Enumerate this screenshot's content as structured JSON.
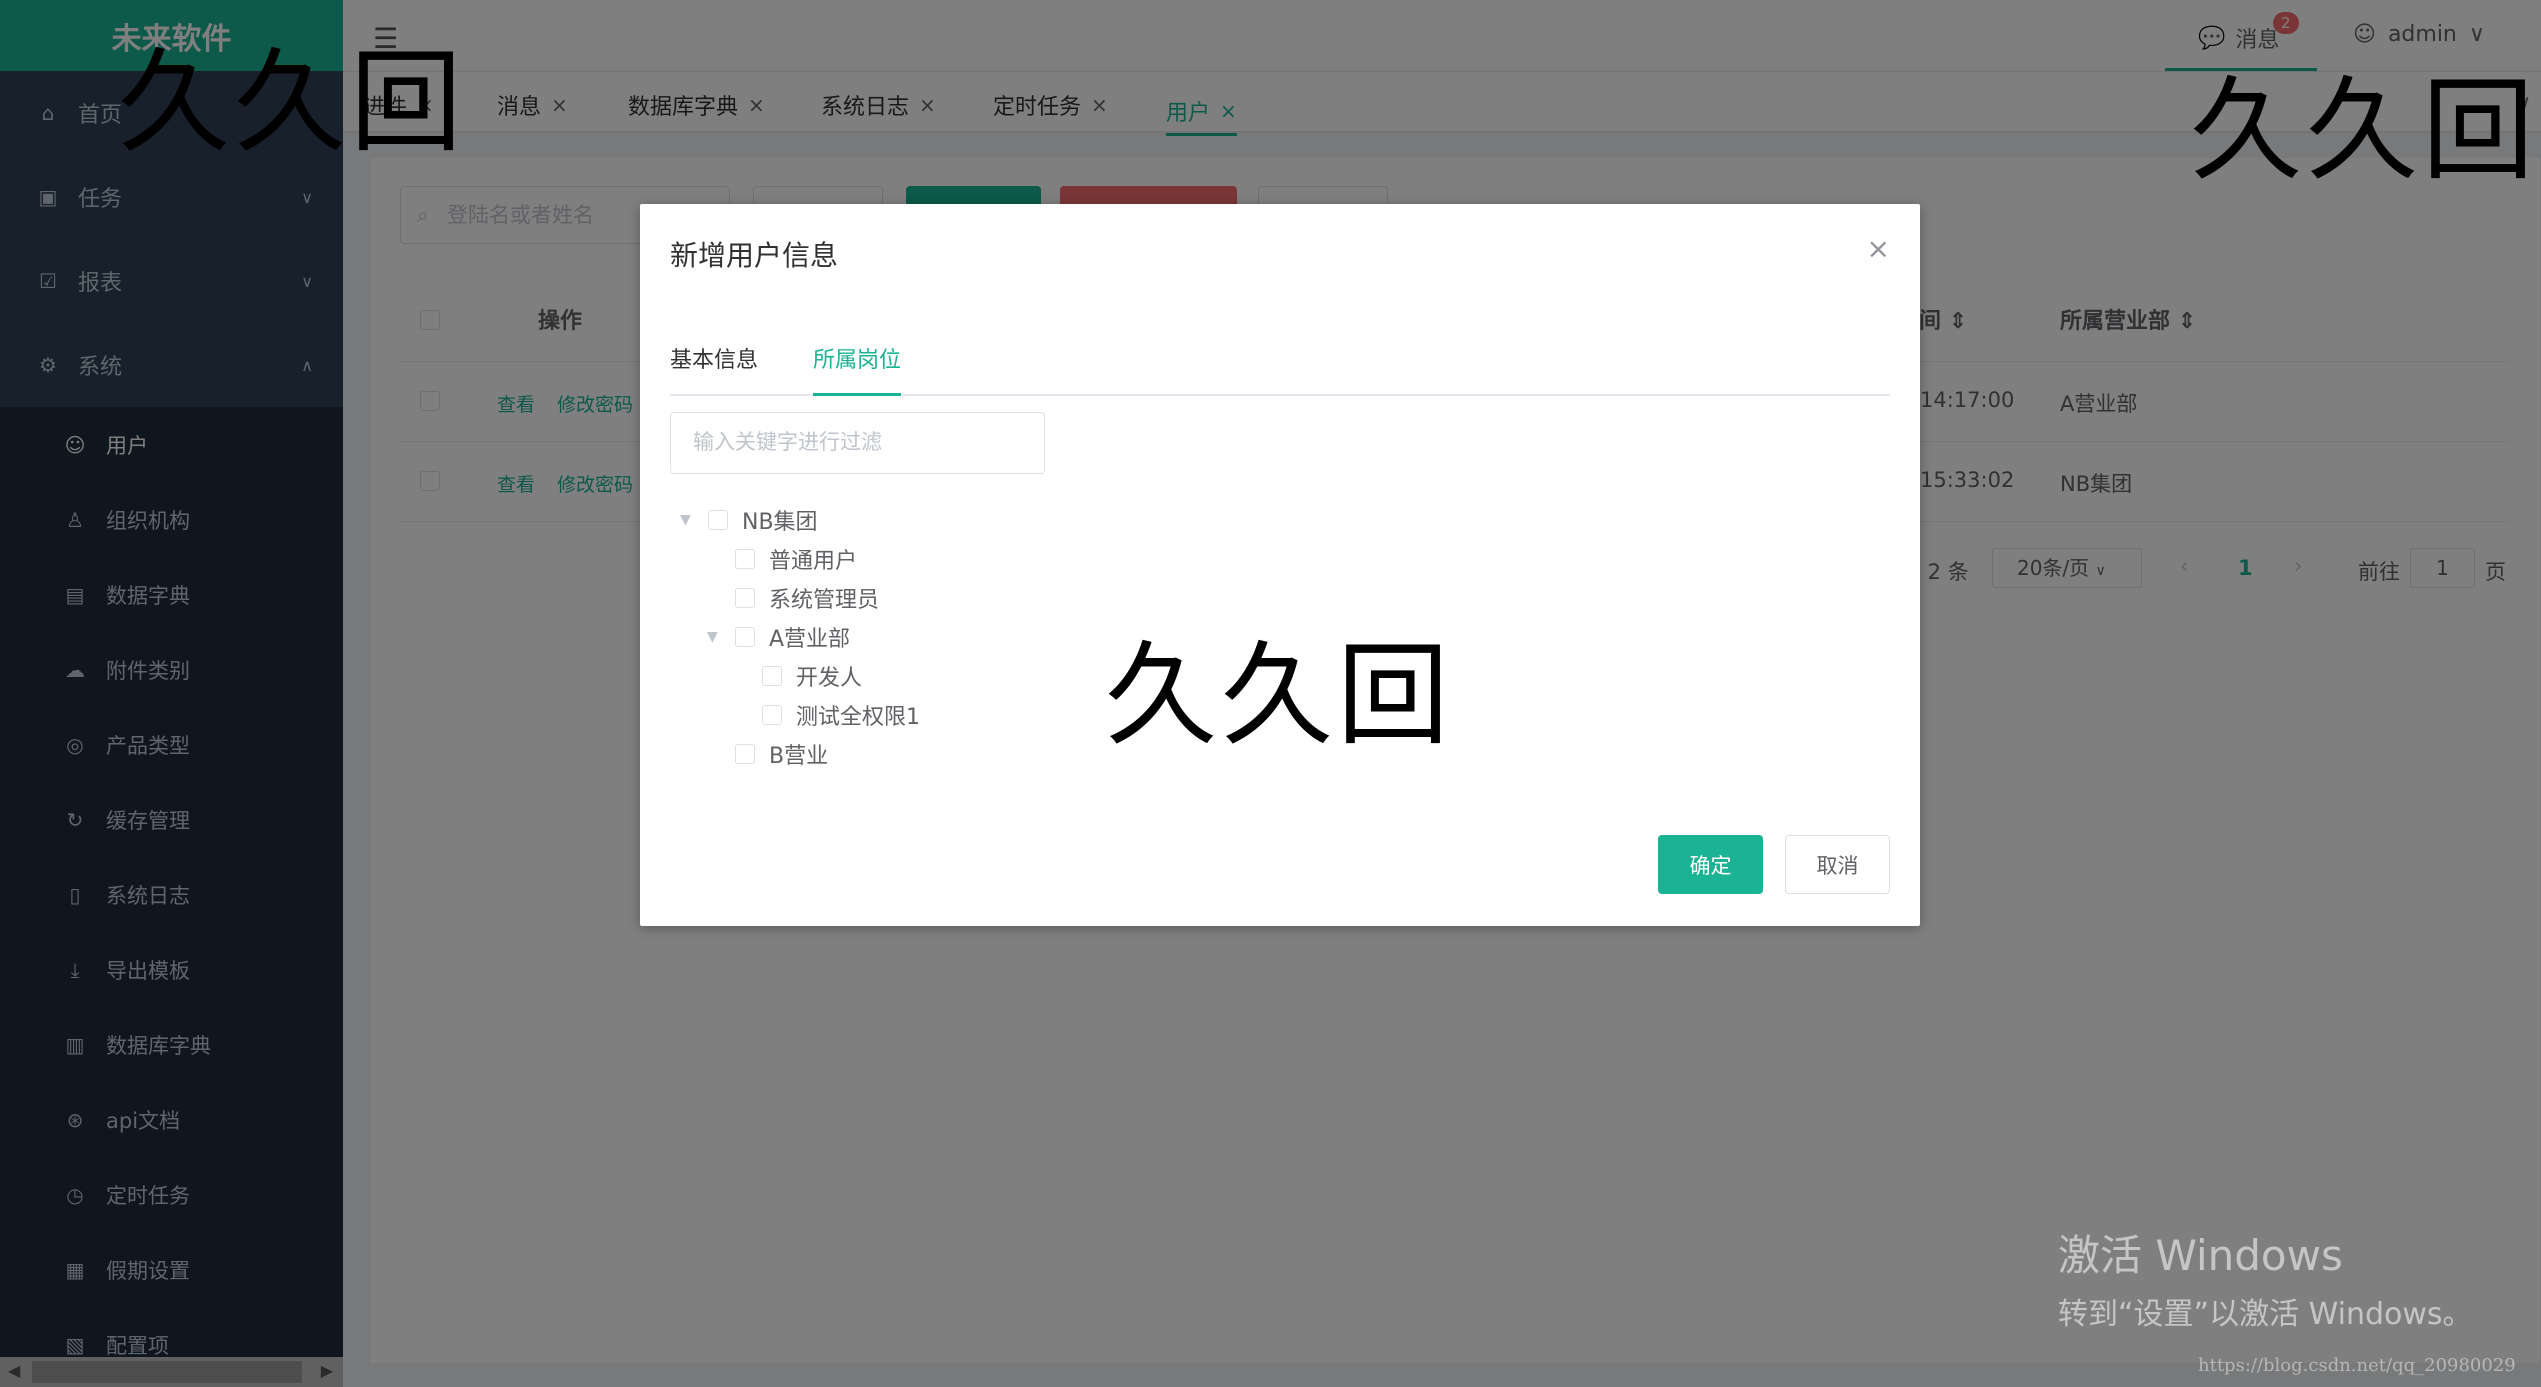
{
  "app": {
    "logo": "未来软件"
  },
  "sidebar": {
    "top_items": [
      {
        "label": "首页",
        "icon": "home-icon"
      },
      {
        "label": "任务",
        "icon": "task-icon",
        "arrow": "∨"
      },
      {
        "label": "报表",
        "icon": "report-icon",
        "arrow": "∨"
      },
      {
        "label": "系统",
        "icon": "gear-icon",
        "arrow": "∧"
      }
    ],
    "sub_items": [
      {
        "label": "用户",
        "icon": "user-icon"
      },
      {
        "label": "组织机构",
        "icon": "org-icon"
      },
      {
        "label": "数据字典",
        "icon": "dict-icon"
      },
      {
        "label": "附件类别",
        "icon": "cloud-upload-icon"
      },
      {
        "label": "产品类型",
        "icon": "target-icon"
      },
      {
        "label": "缓存管理",
        "icon": "refresh-icon"
      },
      {
        "label": "系统日志",
        "icon": "doc-icon"
      },
      {
        "label": "导出模板",
        "icon": "download-icon"
      },
      {
        "label": "数据库字典",
        "icon": "db-icon"
      },
      {
        "label": "api文档",
        "icon": "api-icon"
      },
      {
        "label": "定时任务",
        "icon": "clock-icon"
      },
      {
        "label": "假期设置",
        "icon": "calendar-icon"
      },
      {
        "label": "配置项",
        "icon": "config-icon"
      }
    ]
  },
  "header": {
    "message_label": "消息",
    "message_count": "2",
    "user_name": "admin"
  },
  "tabs": [
    {
      "label": "进件"
    },
    {
      "label": "消息"
    },
    {
      "label": "数据库字典"
    },
    {
      "label": "系统日志"
    },
    {
      "label": "定时任务"
    },
    {
      "label": "用户",
      "active": true
    }
  ],
  "main": {
    "search_placeholder": "登陆名或者姓名",
    "columns": {
      "operation": "操作",
      "time": "间",
      "branch": "所属营业部"
    },
    "rows": [
      {
        "view": "查看",
        "edit_pwd": "修改密码",
        "time": "14:17:00",
        "branch": "A营业部"
      },
      {
        "view": "查看",
        "edit_pwd": "修改密码",
        "time": "15:33:02",
        "branch": "NB集团"
      }
    ],
    "pagination": {
      "total": "共 2 条",
      "page_size": "20条/页",
      "current": "1",
      "goto_label": "前往",
      "goto_value": "1",
      "page_unit": "页"
    }
  },
  "dialog": {
    "title": "新增用户信息",
    "tabs": [
      "基本信息",
      "所属岗位"
    ],
    "active_tab": "所属岗位",
    "filter_placeholder": "输入关键字进行过滤",
    "tree": [
      {
        "label": "NB集团",
        "level": 0,
        "expanded": true
      },
      {
        "label": "普通用户",
        "level": 1
      },
      {
        "label": "系统管理员",
        "level": 1
      },
      {
        "label": "A营业部",
        "level": 1,
        "expanded": true
      },
      {
        "label": "开发人",
        "level": 2
      },
      {
        "label": "测试全权限1",
        "level": 2
      },
      {
        "label": "B营业",
        "level": 1
      }
    ],
    "confirm": "确定",
    "cancel": "取消"
  },
  "watermark": "久久回",
  "windows_activation": {
    "line1": "激活 Windows",
    "line2": "转到“设置”以激活 Windows。"
  },
  "source_watermark": "https://blog.csdn.net/qq_20980029"
}
